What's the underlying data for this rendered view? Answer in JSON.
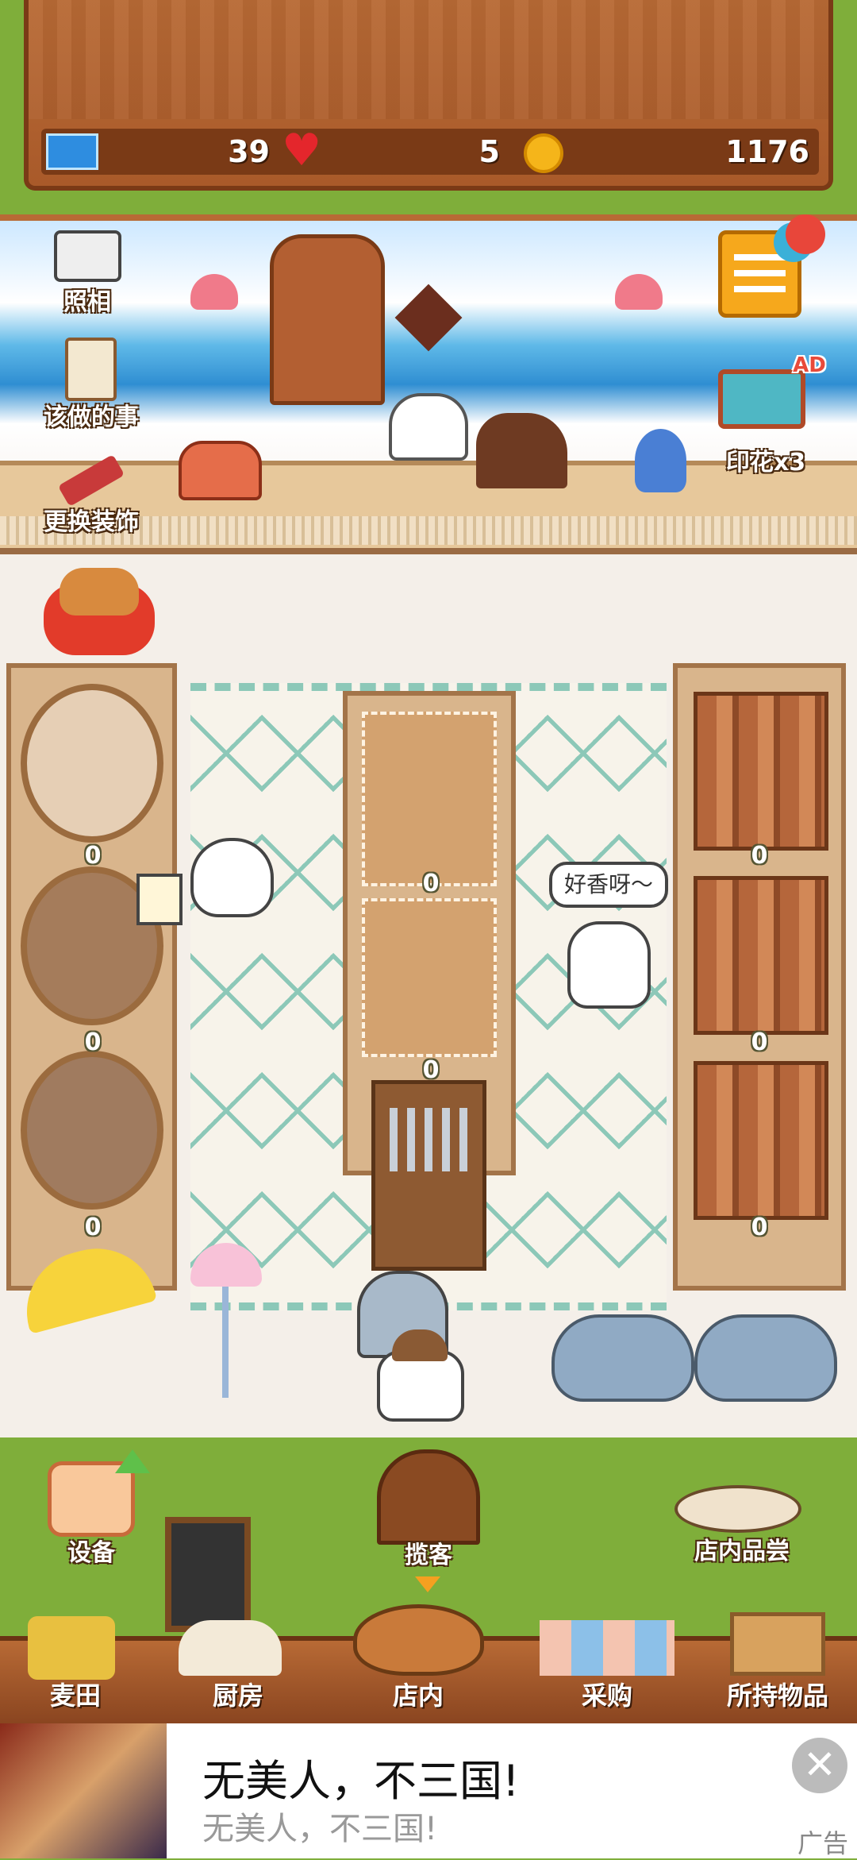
{
  "stats": {
    "tickets": "39",
    "hearts": "5",
    "coins": "1176"
  },
  "side_buttons": {
    "photo": "照相",
    "todo": "该做的事",
    "decorate": "更换装饰",
    "stamps": "印花x3",
    "ad_badge": "AD"
  },
  "speech_bubble": "好香呀～",
  "left_shelf_counts": [
    "0",
    "0",
    "0"
  ],
  "center_shelf_counts": [
    "0",
    "0"
  ],
  "right_shelf_counts": [
    "0",
    "0",
    "0"
  ],
  "action_buttons": {
    "equipment": "设备",
    "solicit": "揽客",
    "tasting": "店内品尝"
  },
  "nav": {
    "wheat": "麦田",
    "kitchen": "厨房",
    "store": "店内",
    "purchase": "采购",
    "inventory": "所持物品"
  },
  "ad": {
    "title": "无美人，不三国!",
    "subtitle": "无美人，不三国!",
    "label": "广告"
  },
  "colors": {
    "wood": "#b86a35",
    "grass": "#7fae3a",
    "rug_line": "#8cc8b8"
  }
}
